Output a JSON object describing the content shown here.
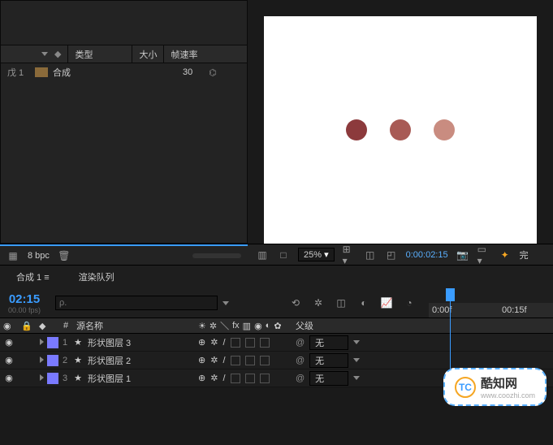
{
  "project": {
    "columns": {
      "type": "类型",
      "size": "大小",
      "fps": "帧速率"
    },
    "row": {
      "name": "合成",
      "label_left": "戊 1",
      "fps": "30"
    }
  },
  "canvas": {
    "dots": [
      "#8c3a3c",
      "#a85a55",
      "#c98c80"
    ]
  },
  "project_footer": {
    "bpc": "8 bpc"
  },
  "viewer_footer": {
    "zoom": "25%",
    "timecode": "0:00:02:15",
    "tick": "00:15f",
    "last": "完"
  },
  "timeline": {
    "tabs": {
      "comp": "合成 1",
      "render": "渲染队列",
      "hamburger": "≡"
    },
    "timecode": "02:15",
    "timecode_sub": "00.00 fps)",
    "search_placeholder": "ρ.",
    "ruler": {
      "t0": "0:00f",
      "t1": "00:15f"
    },
    "cols": {
      "hash": "#",
      "source": "源名称",
      "parent": "父级"
    },
    "layers": [
      {
        "num": "1",
        "name": "形状图层 3",
        "parent": "无"
      },
      {
        "num": "2",
        "name": "形状图层 2",
        "parent": "无"
      },
      {
        "num": "3",
        "name": "形状图层 1",
        "parent": "无"
      }
    ],
    "switch_glyphs": {
      "sun": "☀",
      "fx": "/",
      "cube": "◧"
    }
  },
  "watermark": {
    "logo": "TC",
    "name": "酷知网",
    "url": "www.coozhi.com"
  }
}
